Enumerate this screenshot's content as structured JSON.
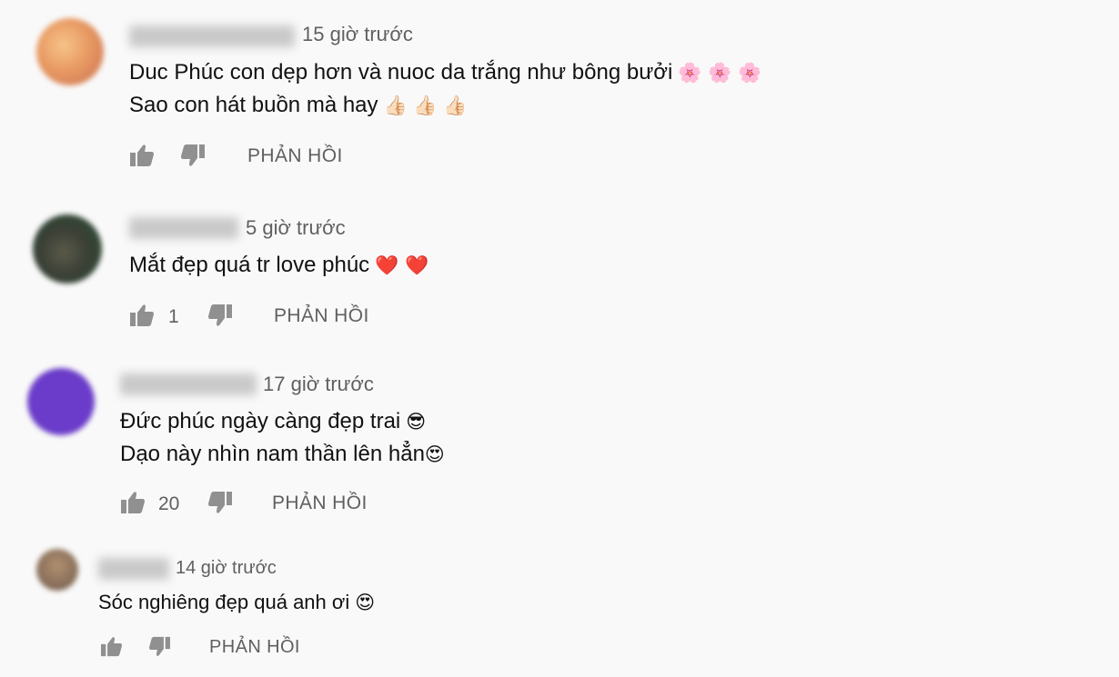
{
  "comments": [
    {
      "time": "15 giờ trước",
      "lines": [
        {
          "text": "Duc Phúc con dẹp hơn và nuoc da trắng như bông bưởi",
          "emoji": "🌸 🌸 🌸"
        },
        {
          "text": "Sao con hát buồn mà hay",
          "emoji": "👍🏻 👍🏻 👍🏻"
        }
      ],
      "likes": "",
      "reply_label": "PHẢN HỒI"
    },
    {
      "time": "5 giờ trước",
      "lines": [
        {
          "text": "Mắt đẹp quá tr love phúc",
          "emoji": "❤️ ❤️"
        }
      ],
      "likes": "1",
      "reply_label": "PHẢN HỒI"
    },
    {
      "time": "17 giờ trước",
      "lines": [
        {
          "text": "Đức phúc ngày càng đẹp trai",
          "emoji": "😎"
        },
        {
          "text": "Dạo này nhìn nam thần lên hẳn",
          "emoji": "😍"
        }
      ],
      "likes": "20",
      "reply_label": "PHẢN HỒI"
    },
    {
      "time": "14 giờ trước",
      "lines": [
        {
          "text": "Sóc nghiêng đẹp quá anh ơi",
          "emoji": "😍"
        }
      ],
      "likes": "",
      "reply_label": "PHẢN HỒI"
    }
  ],
  "icons": {
    "like": "thumbs-up-icon",
    "dislike": "thumbs-down-icon"
  },
  "colors": {
    "background": "#f9f9f9",
    "secondary_text": "#606060",
    "icon": "#909090"
  }
}
